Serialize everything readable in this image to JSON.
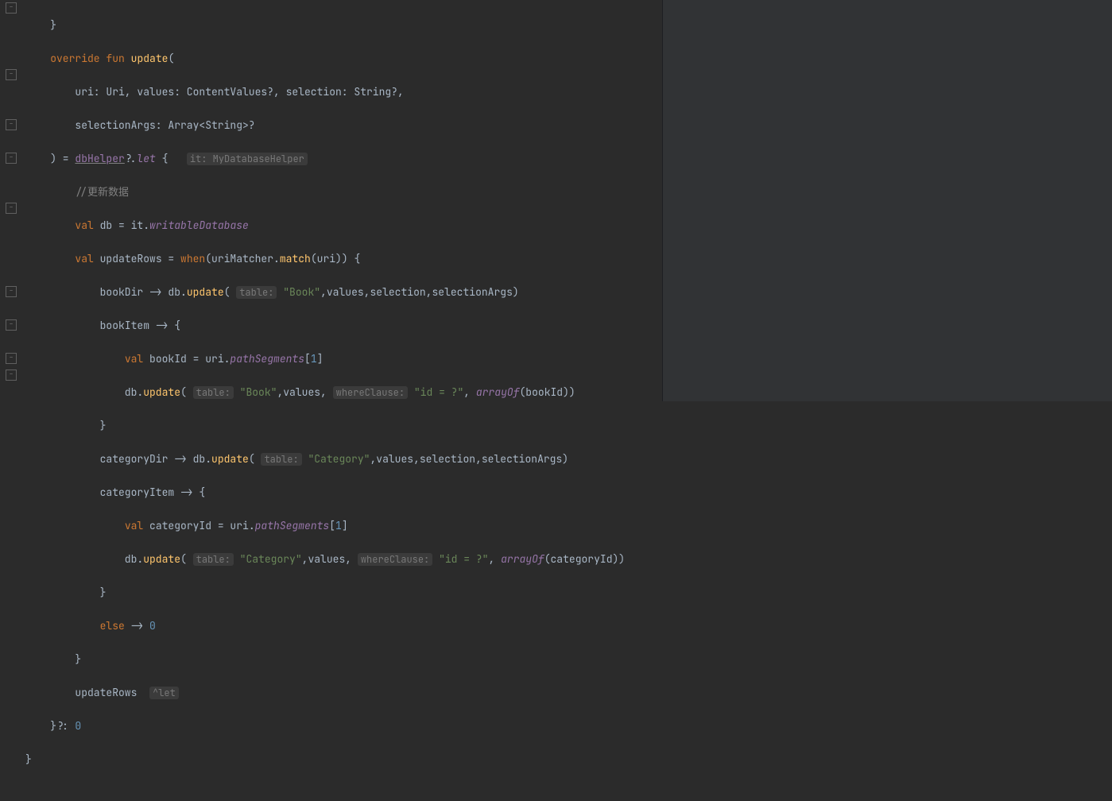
{
  "code": {
    "l1": "    }",
    "l2a": "    ",
    "l2b": "override",
    "l2c": " ",
    "l2d": "fun",
    "l2e": " ",
    "l2f": "update",
    "l2g": "(",
    "l3": "        uri: Uri, values: ContentValues?, selection: String?,",
    "l4": "        selectionArgs: Array<String>?",
    "l5a": "    ) = ",
    "l5b": "dbHelper",
    "l5c": "?.",
    "l5d": "let",
    "l5e": " {   ",
    "l5hint": "it: MyDatabaseHelper",
    "l6a": "        ",
    "l6b": "//更新数据",
    "l7a": "        ",
    "l7b": "val",
    "l7c": " db = ",
    "l7d": "it",
    "l7e": ".",
    "l7f": "writableDatabase",
    "l8a": "        ",
    "l8b": "val",
    "l8c": " updateRows = ",
    "l8d": "when",
    "l8e": "(uriMatcher.",
    "l8f": "match",
    "l8g": "(uri)) {",
    "l9a": "            bookDir -> db.",
    "l9b": "update",
    "l9c": "( ",
    "l9hint": "table:",
    "l9d": " ",
    "l9e": "\"Book\"",
    "l9f": ",values,selection,selectionArgs)",
    "l10": "            bookItem -> {",
    "l11a": "                ",
    "l11b": "val",
    "l11c": " bookId = uri.",
    "l11d": "pathSegments",
    "l11e": "[",
    "l11f": "1",
    "l11g": "]",
    "l12a": "                db.",
    "l12b": "update",
    "l12c": "( ",
    "l12hint": "table:",
    "l12d": " ",
    "l12e": "\"Book\"",
    "l12f": ",values, ",
    "l12hint2": "whereClause:",
    "l12g": " ",
    "l12h": "\"id = ?\"",
    "l12i": ", ",
    "l12j": "arrayOf",
    "l12k": "(bookId))",
    "l13": "            }",
    "l14a": "            categoryDir -> db.",
    "l14b": "update",
    "l14c": "( ",
    "l14hint": "table:",
    "l14d": " ",
    "l14e": "\"Category\"",
    "l14f": ",values,selection,selectionArgs)",
    "l15": "            categoryItem -> {",
    "l16a": "                ",
    "l16b": "val",
    "l16c": " categoryId = uri.",
    "l16d": "pathSegments",
    "l16e": "[",
    "l16f": "1",
    "l16g": "]",
    "l17a": "                db.",
    "l17b": "update",
    "l17c": "( ",
    "l17hint": "table:",
    "l17d": " ",
    "l17e": "\"Category\"",
    "l17f": ",values, ",
    "l17hint2": "whereClause:",
    "l17g": " ",
    "l17h": "\"id = ?\"",
    "l17i": ", ",
    "l17j": "arrayOf",
    "l17k": "(categoryId))",
    "l18": "            }",
    "l19a": "            ",
    "l19b": "else",
    "l19c": " -> ",
    "l19d": "0",
    "l20": "        }",
    "l21a": "        updateRows  ",
    "l21hint": "^let",
    "l22a": "    }?: ",
    "l22b": "0",
    "l23": "}"
  },
  "fold_rows": [
    1,
    5,
    8,
    10,
    13,
    18,
    20,
    22,
    23
  ]
}
